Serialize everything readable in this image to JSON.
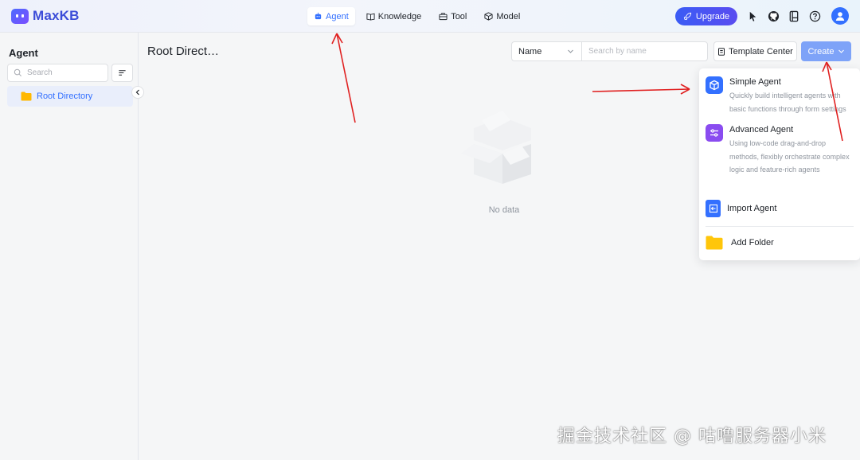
{
  "app": {
    "name": "MaxKB"
  },
  "nav": {
    "items": [
      {
        "label": "Agent",
        "icon": "robot-icon",
        "active": true
      },
      {
        "label": "Knowledge",
        "icon": "book-icon"
      },
      {
        "label": "Tool",
        "icon": "toolbox-icon"
      },
      {
        "label": "Model",
        "icon": "cube-icon"
      }
    ]
  },
  "header": {
    "upgrade_label": "Upgrade"
  },
  "sidebar": {
    "title": "Agent",
    "search_placeholder": "Search",
    "items": [
      {
        "label": "Root Directory",
        "icon": "folder-icon"
      }
    ]
  },
  "main": {
    "title": "Root Direct…",
    "filter": {
      "selected": "Name",
      "placeholder": "Search by name"
    },
    "template_center_label": "Template Center",
    "create_label": "Create",
    "empty_text": "No data"
  },
  "dropdown": {
    "items": [
      {
        "title": "Simple Agent",
        "desc": "Quickly build intelligent agents with basic functions through form settings",
        "icon": "simple-agent-icon",
        "color": "#3370ff"
      },
      {
        "title": "Advanced Agent",
        "desc": "Using low-code drag-and-drop methods, flexibly orchestrate complex logic and feature-rich agents",
        "icon": "advanced-agent-icon",
        "color": "#8a4cf0"
      },
      {
        "title": "Import Agent",
        "icon": "import-icon",
        "color": "#3370ff"
      },
      {
        "title": "Add Folder",
        "icon": "folder-icon",
        "color": "#ffc60a"
      }
    ]
  },
  "watermark": "掘金技术社区 @ 咕噜服务器小米",
  "colors": {
    "primary": "#3370ff",
    "create_button": "#7ea3f8",
    "annotation": "#e02020"
  }
}
